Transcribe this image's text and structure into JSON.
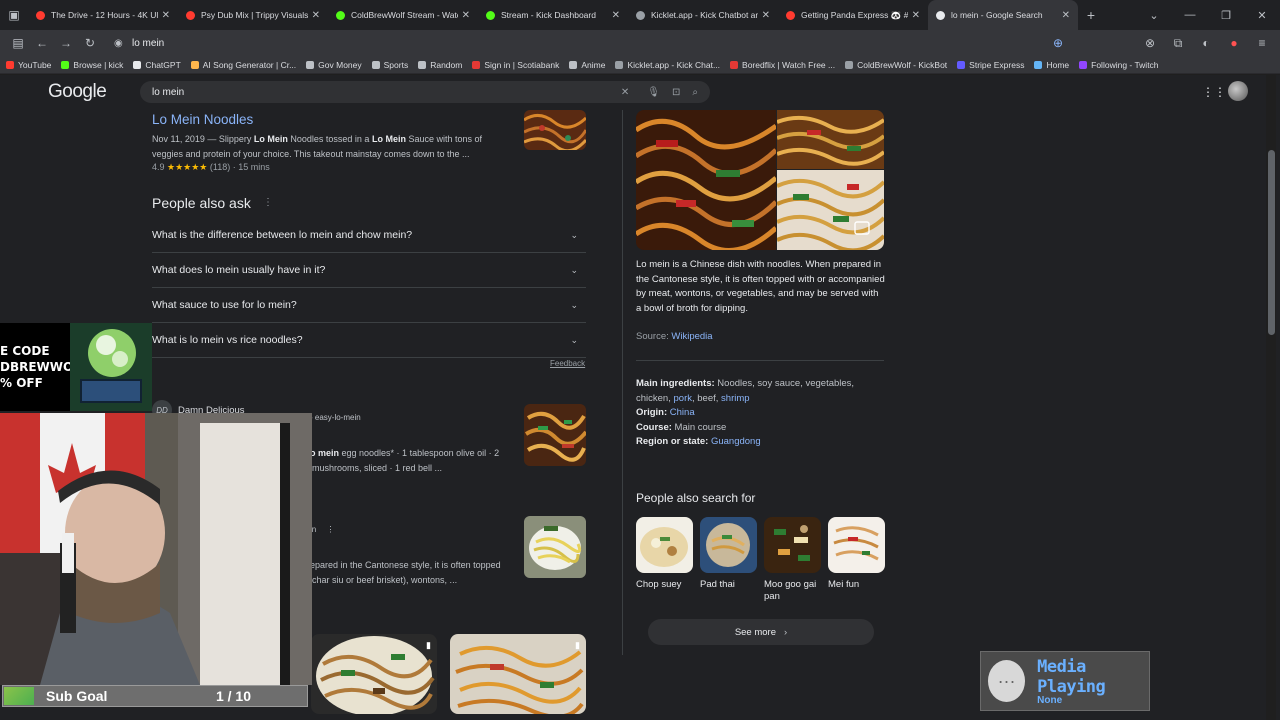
{
  "tabs": [
    {
      "label": "The Drive - 12 Hours - 4K Ultra",
      "color": "#ff3b30",
      "active": false
    },
    {
      "label": "Psy Dub Mix | Trippy Visuals + M",
      "color": "#ff3b30",
      "active": false
    },
    {
      "label": "ColdBrewWolf Stream - Watch Li",
      "color": "#53fc18",
      "active": false
    },
    {
      "label": "Stream - Kick Dashboard",
      "color": "#53fc18",
      "active": false
    },
    {
      "label": "Kicklet.app - Kick Chatbot and C",
      "color": "#9aa0a6",
      "active": false
    },
    {
      "label": "Getting Panda Express 🐼 #pan",
      "color": "#ff3b30",
      "active": false
    },
    {
      "label": "lo mein - Google Search",
      "color": "#e8eaed",
      "active": true
    }
  ],
  "address": {
    "url": "lo mein"
  },
  "bookmarks": [
    {
      "label": "YouTube",
      "color": "#ff3b30"
    },
    {
      "label": "Browse | kick",
      "color": "#53fc18"
    },
    {
      "label": "ChatGPT",
      "color": "#e8eaed"
    },
    {
      "label": "AI Song Generator | Cr...",
      "color": "#ffb74d"
    },
    {
      "label": "Gov Money",
      "color": "#bdc1c6"
    },
    {
      "label": "Sports",
      "color": "#bdc1c6"
    },
    {
      "label": "Random",
      "color": "#bdc1c6"
    },
    {
      "label": "Sign in | Scotiabank",
      "color": "#e53935"
    },
    {
      "label": "Anime",
      "color": "#bdc1c6"
    },
    {
      "label": "Kicklet.app - Kick Chat...",
      "color": "#9aa0a6"
    },
    {
      "label": "Boredflix | Watch Free ...",
      "color": "#e53935"
    },
    {
      "label": "ColdBrewWolf - KickBot",
      "color": "#9aa0a6"
    },
    {
      "label": "Stripe Express",
      "color": "#635bff"
    },
    {
      "label": "Home",
      "color": "#64b5f6"
    },
    {
      "label": "Following - Twitch",
      "color": "#9146ff"
    }
  ],
  "google": {
    "logo": "Google",
    "query": "lo mein"
  },
  "result1": {
    "title": "Lo Mein Noodles",
    "date": "Nov 11, 2019 — Slippery ",
    "b1": "Lo Mein",
    "s1": " Noodles tossed in a ",
    "b2": "Lo Mein",
    "s2": " Sauce with tons of",
    "line2": "veggies and protein of your choice. This takeout mainstay comes down to the ...",
    "rating": "4.9",
    "stars": "★★★★★",
    "meta": "(118) · 15 mins"
  },
  "paa": {
    "title": "People also ask",
    "questions": [
      "What is the difference between lo mein and chow mein?",
      "What does lo mein usually have in it?",
      "What sauce to use for lo mein?",
      "What is lo mein vs rice noodles?"
    ],
    "feedback": "Feedback"
  },
  "result2": {
    "site": "Damn Delicious",
    "site_badge": "DD",
    "crumb": "› easy-lo-mein",
    "b1": "o mein",
    "s1": " egg noodles* · 1 tablespoon olive oil · 2",
    "s2": "mushrooms, sliced · 1 red bell ..."
  },
  "result3": {
    "crumb": "in",
    "s1": "epared in the Cantonese style, it is often topped",
    "s2": "char siu or beef brisket), wontons, ..."
  },
  "kp": {
    "desc": "Lo mein is a Chinese dish with noodles. When prepared in the Cantonese style, it is often topped with or accompanied by meat, wontons, or vegetables, and may be served with a bowl of broth for dipping.",
    "source_label": "Source: ",
    "source_link": "Wikipedia",
    "ingredients_key": "Main ingredients:",
    "ingredients_a": " Noodles, soy sauce, vegetables,",
    "ingredients_b": "chicken, ",
    "pork": "pork",
    "beef": ", beef, ",
    "shrimp": "shrimp",
    "origin_key": "Origin:",
    "origin": "China",
    "course_key": "Course:",
    "course": "Main course",
    "region_key": "Region or state:",
    "region": "Guangdong",
    "pas_title": "People also search for",
    "pas": [
      "Chop suey",
      "Pad thai",
      "Moo goo gai pan",
      "Mei fun"
    ],
    "see_more": "See more"
  },
  "overlay": {
    "promo_lines": [
      "E CODE",
      "DBREWWOLF",
      "% OFF"
    ],
    "sub_goal_label": "Sub Goal",
    "sub_goal_progress": "1 / 10",
    "media_title": "Media Playing",
    "media_sub": "None"
  }
}
